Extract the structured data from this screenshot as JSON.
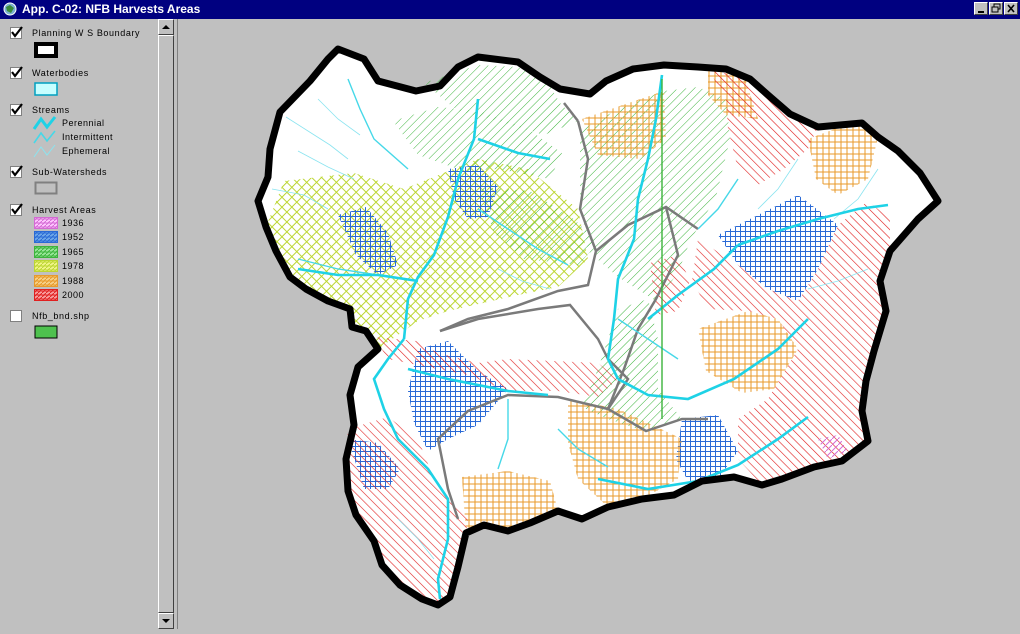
{
  "window": {
    "title": "App. C-02:  NFB Harvests Areas",
    "controls": [
      "minimize",
      "restore",
      "close"
    ]
  },
  "legend": {
    "layers": [
      {
        "name": "Planning W S Boundary",
        "checked": true,
        "symbol": {
          "type": "box",
          "outline": "#000000",
          "fill": "#ffffff"
        }
      },
      {
        "name": "Waterbodies",
        "checked": true,
        "symbol": {
          "type": "box",
          "outline": "#00a0c0",
          "fill": "#c8ffff"
        }
      },
      {
        "name": "Streams",
        "checked": true,
        "symbol": {
          "type": "lines",
          "classes": [
            {
              "label": "Perennial",
              "color": "#1ed2e6"
            },
            {
              "label": "Intermittent",
              "color": "#46d8e8"
            },
            {
              "label": "Ephemeral",
              "color": "#8ae4f0"
            }
          ]
        }
      },
      {
        "name": "Sub-Watersheds",
        "checked": true,
        "symbol": {
          "type": "box",
          "outline": "#808080",
          "fill": "#c0c0c0"
        }
      },
      {
        "name": "Harvest Areas",
        "checked": true,
        "symbol": {
          "type": "classes",
          "classes": [
            {
              "label": "1936",
              "color": "#d46ad4",
              "fill": "#ffc8ff"
            },
            {
              "label": "1952",
              "color": "#2a6ad6",
              "fill": "#6fa8e8"
            },
            {
              "label": "1965",
              "color": "#3cb43c",
              "fill": "#9ae69a"
            },
            {
              "label": "1978",
              "color": "#bcd632",
              "fill": "#f2f58c"
            },
            {
              "label": "1988",
              "color": "#e89a2a",
              "fill": "#f6d28a"
            },
            {
              "label": "2000",
              "color": "#e02020",
              "fill": "#f8a0a0"
            }
          ]
        }
      },
      {
        "name": "Nfb_bnd.shp",
        "checked": false,
        "symbol": {
          "type": "box",
          "outline": "#000000",
          "fill": "#4ec14e"
        }
      }
    ]
  },
  "map": {
    "background": "#c0c0c0",
    "watershed_fill": "#ffffff",
    "boundary_color": "#000000",
    "subwatershed_line_color": "#7a7a7a"
  }
}
